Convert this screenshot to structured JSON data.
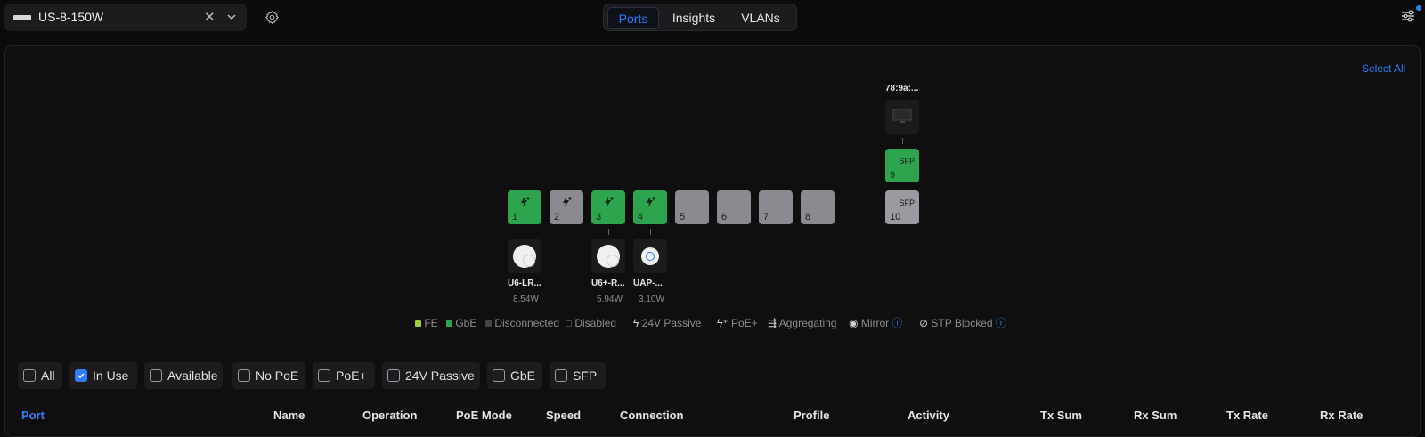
{
  "header": {
    "device_name": "US-8-150W",
    "tabs": [
      "Ports",
      "Insights",
      "VLANs"
    ],
    "active_tab": "Ports"
  },
  "panel": {
    "select_all": "Select All",
    "ports": [
      {
        "num": "1",
        "state": "GbE",
        "poe": "PoE+"
      },
      {
        "num": "2",
        "state": "Disconnected",
        "poe": "PoE+"
      },
      {
        "num": "3",
        "state": "GbE",
        "poe": "PoE+"
      },
      {
        "num": "4",
        "state": "GbE",
        "poe": "PoE+"
      },
      {
        "num": "5",
        "state": "Disconnected"
      },
      {
        "num": "6",
        "state": "Disconnected"
      },
      {
        "num": "7",
        "state": "Disconnected"
      },
      {
        "num": "8",
        "state": "Disconnected"
      },
      {
        "num": "9",
        "state": "GbE",
        "type": "SFP"
      },
      {
        "num": "10",
        "state": "Disconnected",
        "type": "SFP"
      }
    ],
    "sfp_label": "SFP",
    "devices": [
      {
        "port": "1",
        "name": "U6-LR...",
        "power": "8.54W"
      },
      {
        "port": "3",
        "name": "U6+-R...",
        "power": "5.94W"
      },
      {
        "port": "4",
        "name": "UAP-...",
        "power": "3.10W"
      },
      {
        "port": "9",
        "name": "78:9a:..."
      }
    ]
  },
  "legend": {
    "fe": "FE",
    "gbe": "GbE",
    "disconnected": "Disconnected",
    "disabled": "Disabled",
    "passive24": "24V Passive",
    "poeplus": "PoE+",
    "aggregating": "Aggregating",
    "mirror": "Mirror",
    "stp": "STP Blocked"
  },
  "colors": {
    "accent": "#2d7ff9",
    "port_up": "#2ea44f",
    "fe": "#9acd32",
    "port_down": "#8a8b90"
  },
  "filters": [
    {
      "label": "All",
      "checked": false
    },
    {
      "label": "In Use",
      "checked": true
    },
    {
      "label": "Available",
      "checked": false
    },
    {
      "label": "No PoE",
      "checked": false
    },
    {
      "label": "PoE+",
      "checked": false
    },
    {
      "label": "24V Passive",
      "checked": false
    },
    {
      "label": "GbE",
      "checked": false
    },
    {
      "label": "SFP",
      "checked": false
    }
  ],
  "table": {
    "columns": [
      "Port",
      "Name",
      "Operation",
      "PoE Mode",
      "Speed",
      "Connection",
      "Profile",
      "Activity",
      "Tx Sum",
      "Rx Sum",
      "Tx Rate",
      "Rx Rate"
    ],
    "sorted_column": "Port"
  }
}
